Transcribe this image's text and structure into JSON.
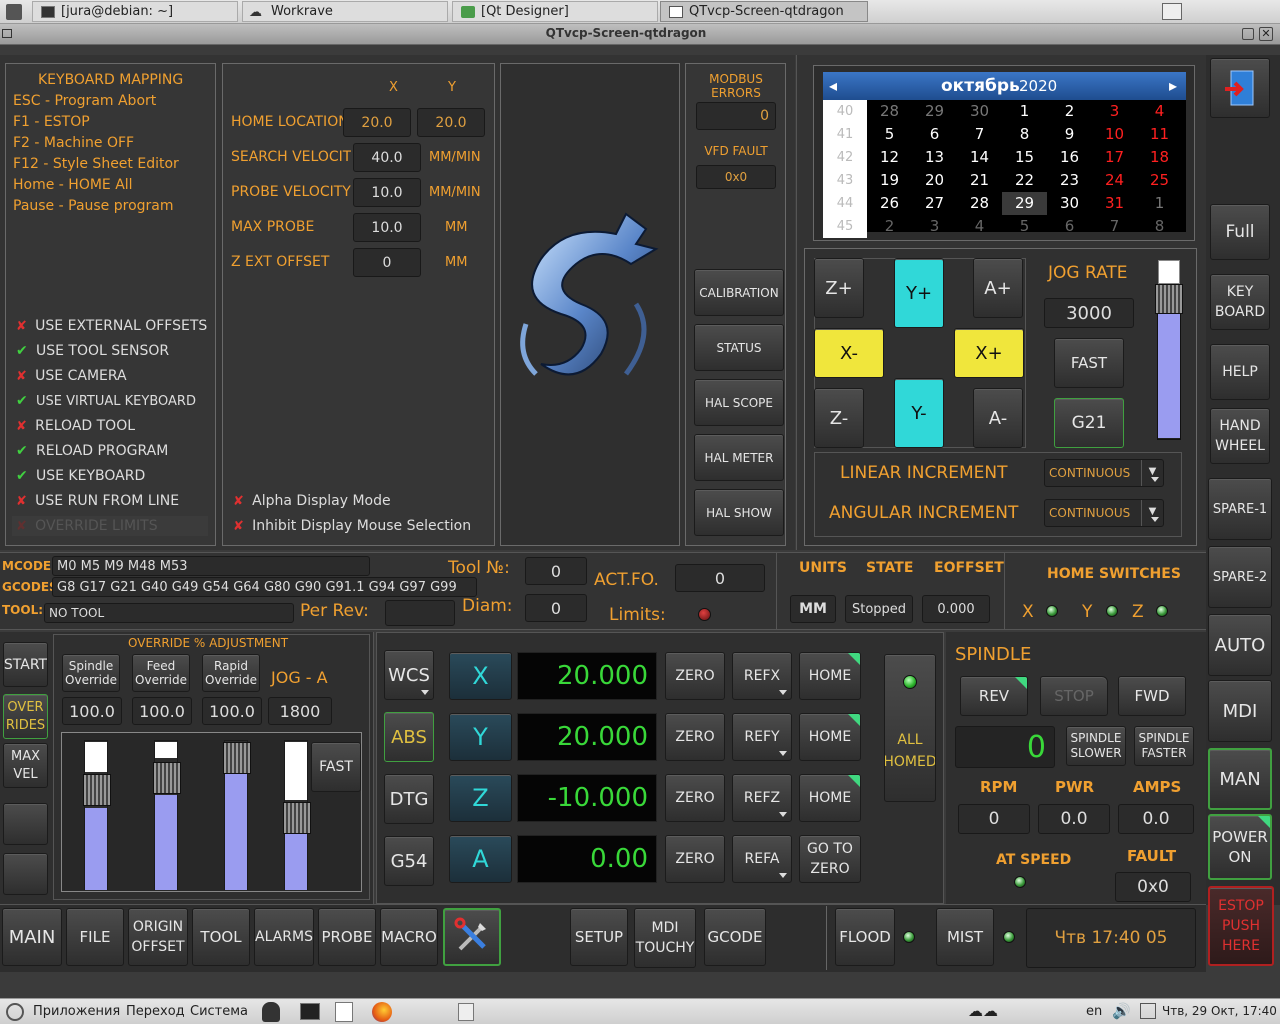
{
  "taskbar_top": {
    "tabs": [
      "[jura@debian: ~]",
      "Workrave",
      "[Qt Designer]",
      "QTvcp-Screen-qtdragon"
    ]
  },
  "window": {
    "title": "QTvcp-Screen-qtdragon"
  },
  "keyboard_mapping": {
    "title": "KEYBOARD MAPPING",
    "lines": [
      "ESC - Program Abort",
      "F1 - ESTOP",
      "F2 - Machine OFF",
      "F12 - Style Sheet Editor",
      "Home - HOME All",
      "Pause - Pause program"
    ]
  },
  "options": [
    {
      "state": "x",
      "label": "USE EXTERNAL OFFSETS"
    },
    {
      "state": "ok",
      "label": "USE TOOL SENSOR"
    },
    {
      "state": "x",
      "label": "USE CAMERA"
    },
    {
      "state": "ok",
      "label": "USE VIRTUAL KEYBOARD"
    },
    {
      "state": "x",
      "label": "RELOAD TOOL"
    },
    {
      "state": "ok",
      "label": "RELOAD PROGRAM"
    },
    {
      "state": "ok",
      "label": "USE KEYBOARD"
    },
    {
      "state": "x",
      "label": "USE RUN FROM LINE"
    },
    {
      "state": "x",
      "label": "OVERRIDE LIMITS"
    }
  ],
  "settings": {
    "x_label": "X",
    "y_label": "Y",
    "rows": [
      {
        "label": "HOME LOCATION",
        "v1": "20.0",
        "v2": "20.0",
        "unit": ""
      },
      {
        "label": "SEARCH VELOCITY",
        "v1": "40.0",
        "v2": "",
        "unit": "MM/MIN"
      },
      {
        "label": "PROBE VELOCITY",
        "v1": "10.0",
        "v2": "",
        "unit": "MM/MIN"
      },
      {
        "label": "MAX PROBE",
        "v1": "10.0",
        "v2": "",
        "unit": "MM"
      },
      {
        "label": "Z EXT OFFSET",
        "v1": "0",
        "v2": "",
        "unit": "MM"
      }
    ],
    "alpha_display": "Alpha Display Mode",
    "inhibit_mouse": "Inhibit Display Mouse Selection"
  },
  "modbus": {
    "title": "MODBUS ERRORS",
    "value": "0",
    "vfd_title": "VFD FAULT",
    "vfd_value": "0x0"
  },
  "side_buttons": [
    "CALIBRATION",
    "STATUS",
    "HAL SCOPE",
    "HAL METER",
    "HAL SHOW"
  ],
  "calendar": {
    "month": "октябрь",
    "year": "2020",
    "weeks": [
      {
        "wk": "40",
        "days": [
          "28",
          "29",
          "30",
          "1",
          "2",
          "3",
          "4"
        ]
      },
      {
        "wk": "41",
        "days": [
          "5",
          "6",
          "7",
          "8",
          "9",
          "10",
          "11"
        ]
      },
      {
        "wk": "42",
        "days": [
          "12",
          "13",
          "14",
          "15",
          "16",
          "17",
          "18"
        ]
      },
      {
        "wk": "43",
        "days": [
          "19",
          "20",
          "21",
          "22",
          "23",
          "24",
          "25"
        ]
      },
      {
        "wk": "44",
        "days": [
          "26",
          "27",
          "28",
          "29",
          "30",
          "31",
          "1"
        ]
      },
      {
        "wk": "45",
        "days": [
          "2",
          "3",
          "4",
          "5",
          "6",
          "7",
          "8"
        ]
      }
    ],
    "selected": "29"
  },
  "jog": {
    "z_plus": "Z+",
    "y_plus": "Y+",
    "a_plus": "A+",
    "x_minus": "X-",
    "x_plus": "X+",
    "z_minus": "Z-",
    "y_minus": "Y-",
    "a_minus": "A-",
    "rate_label": "JOG RATE",
    "rate_value": "3000",
    "fast": "FAST",
    "units": "G21",
    "linear_label": "LINEAR INCREMENT",
    "linear_value": "CONTINUOUS",
    "angular_label": "ANGULAR INCREMENT",
    "angular_value": "CONTINUOUS"
  },
  "right_bar": [
    "Full",
    "KEY BOARD",
    "HELP",
    "HAND WHEEL",
    "SPARE-1",
    "SPARE-2",
    "AUTO",
    "MDI",
    "MAN",
    "POWER ON",
    "ESTOP PUSH HERE"
  ],
  "codes": {
    "mcodes_label": "MCODES:",
    "mcodes": "M0 M5 M9 M48 M53",
    "gcodes_label": "GCODES:",
    "gcodes": "G8 G17 G21 G40 G49 G54 G64 G80 G90 G91.1 G94 G97 G99",
    "tool_label": "TOOL:",
    "tool": "NO TOOL",
    "tool_no_label": "Tool №:",
    "tool_no": "0",
    "actfo_label": "ACT.FO.",
    "actfo": "0",
    "per_rev_label": "Per Rev:",
    "diam_label": "Diam:",
    "diam": "0",
    "limits_label": "Limits:"
  },
  "status": {
    "units_label": "UNITS",
    "units": "MM",
    "state_label": "STATE",
    "state": "Stopped",
    "eoffset_label": "EOFFSET",
    "eoffset": "0.000",
    "home_switches": "HOME SWITCHES",
    "x": "X",
    "y": "Y",
    "z": "Z"
  },
  "overrides": {
    "title": "OVERRIDE  %  ADJUSTMENT",
    "start": "START",
    "overrides": "OVER RIDES",
    "max_vel": "MAX VEL",
    "labels": [
      "Spindle Override",
      "Feed Override",
      "Rapid Override"
    ],
    "values": [
      "100.0",
      "100.0",
      "100.0",
      "1800"
    ],
    "jog_a": "JOG - A",
    "fast": "FAST"
  },
  "dro": {
    "modes": [
      "WCS",
      "ABS",
      "DTG",
      "G54"
    ],
    "axes": [
      {
        "axis": "X",
        "value": "20.000",
        "ref": "REFX",
        "home": "HOME"
      },
      {
        "axis": "Y",
        "value": "20.000",
        "ref": "REFY",
        "home": "HOME"
      },
      {
        "axis": "Z",
        "value": "-10.000",
        "ref": "REFZ",
        "home": "HOME"
      },
      {
        "axis": "A",
        "value": "0.00",
        "ref": "REFA",
        "home": "GO TO ZERO"
      }
    ],
    "zero": "ZERO",
    "all_homed": "ALL HOMED"
  },
  "spindle": {
    "title": "SPINDLE",
    "rev": "REV",
    "stop": "STOP",
    "fwd": "FWD",
    "speed": "0",
    "slower": "SPINDLE SLOWER",
    "faster": "SPINDLE FASTER",
    "rpm_label": "RPM",
    "rpm": "0",
    "pwr_label": "PWR",
    "pwr": "0.0",
    "amps_label": "AMPS",
    "amps": "0.0",
    "at_speed": "AT SPEED",
    "fault_label": "FAULT",
    "fault": "0x0"
  },
  "bottom_tabs": [
    "MAIN",
    "FILE",
    "ORIGIN OFFSET",
    "TOOL",
    "ALARMS",
    "PROBE",
    "MACRO"
  ],
  "bottom_mid": [
    "SETUP",
    "MDI TOUCHY",
    "GCODE"
  ],
  "coolant": {
    "flood": "FLOOD",
    "mist": "MIST"
  },
  "clock": "Чтв 17:40 05",
  "taskbar_bottom": {
    "apps": "Приложения",
    "go": "Переход",
    "system": "Система",
    "lang": "en",
    "datetime": "Чтв, 29 Окт, 17:40"
  }
}
